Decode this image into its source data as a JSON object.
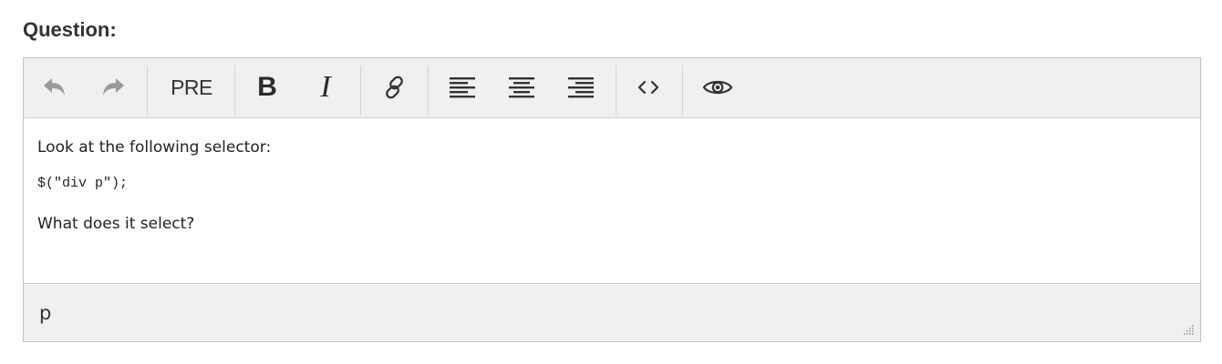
{
  "heading": "Question:",
  "toolbar": {
    "undo_icon": "undo-icon",
    "redo_icon": "redo-icon",
    "pre_label": "PRE",
    "bold_label": "B",
    "italic_label": "I",
    "link_icon": "link-icon",
    "align_left_icon": "align-left-icon",
    "align_center_icon": "align-center-icon",
    "align_right_icon": "align-right-icon",
    "code_icon": "code-icon",
    "preview_icon": "eye-icon"
  },
  "content": {
    "line1": "Look at the following selector:",
    "code": "$(\"div p\");",
    "line2": "What does it select?"
  },
  "statusbar": {
    "path": "p"
  }
}
